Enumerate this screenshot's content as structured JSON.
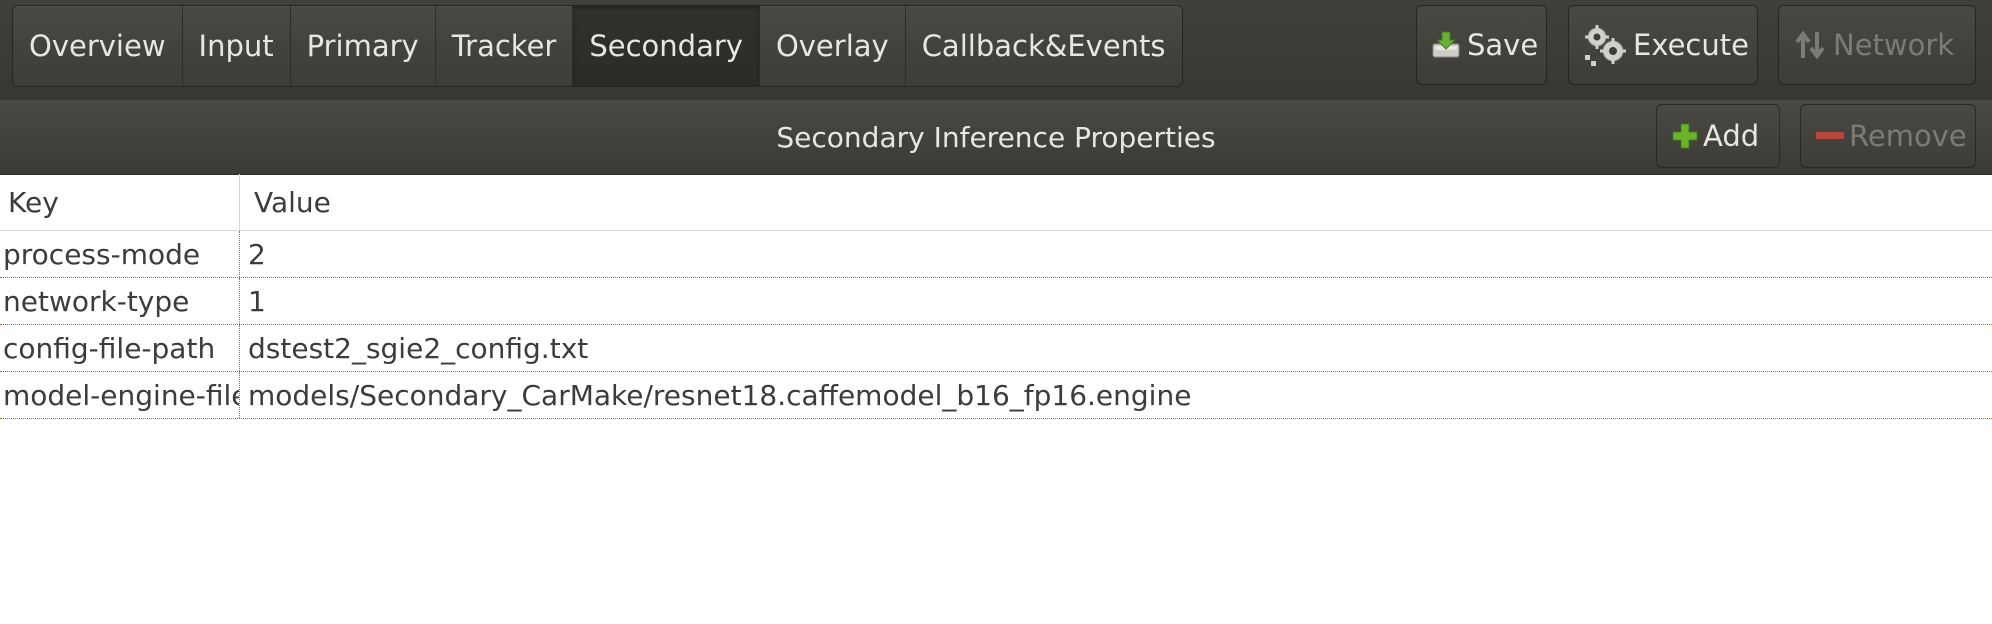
{
  "toolbar": {
    "tabs": [
      {
        "label": "Overview"
      },
      {
        "label": "Input"
      },
      {
        "label": "Primary"
      },
      {
        "label": "Tracker"
      },
      {
        "label": "Secondary"
      },
      {
        "label": "Overlay"
      },
      {
        "label": "Callback&Events"
      }
    ],
    "active_tab": "Secondary",
    "save_label": "Save",
    "execute_label": "Execute",
    "network_label": "Network"
  },
  "header": {
    "title": "Secondary Inference Properties",
    "add_label": "Add",
    "remove_label": "Remove"
  },
  "table": {
    "columns": [
      "Key",
      "Value"
    ],
    "rows": [
      {
        "key": "process-mode",
        "value": "2"
      },
      {
        "key": "network-type",
        "value": "1"
      },
      {
        "key": "config-file-path",
        "value": "dstest2_sgie2_config.txt"
      },
      {
        "key": "model-engine-file",
        "value": "models/Secondary_CarMake/resnet18.caffemodel_b16_fp16.engine"
      }
    ]
  },
  "colors": {
    "toolbar_bg": "#3d3b37",
    "text_light": "#e8e6e1",
    "disabled_text": "#7d7b76",
    "row_separator": "#d3582f",
    "add_green": "#6ab42c",
    "remove_red": "#c8483f"
  }
}
